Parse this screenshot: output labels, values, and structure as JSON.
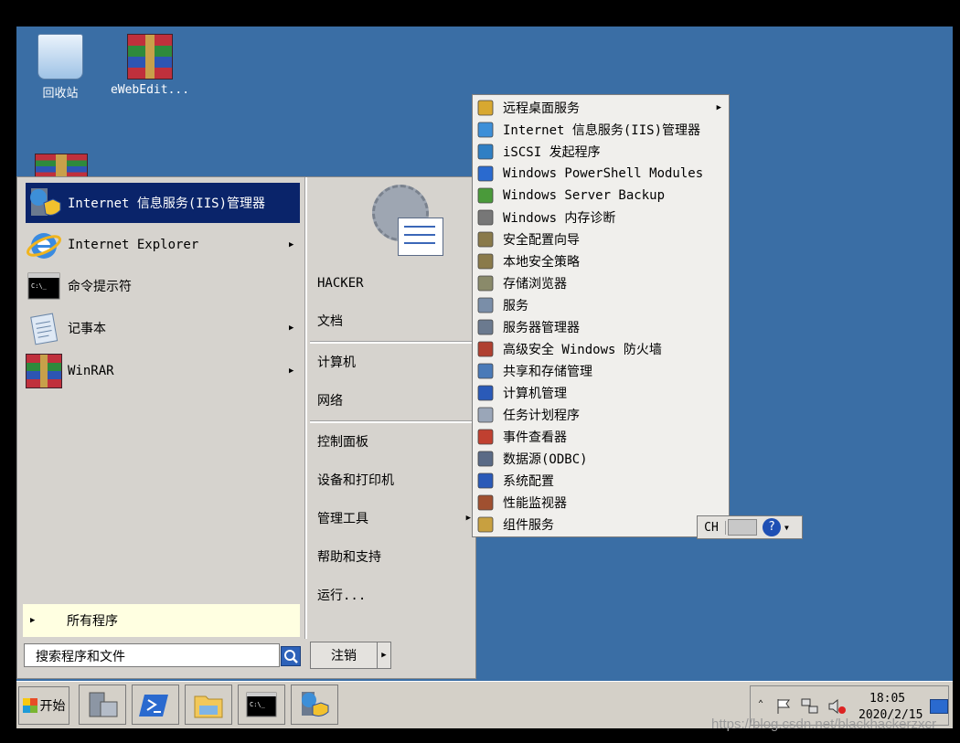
{
  "desktop": {
    "icons": [
      {
        "label": "回收站",
        "icon": "recycle-bin-icon"
      },
      {
        "label": "eWebEdit...",
        "icon": "winrar-archive-icon"
      }
    ]
  },
  "start_menu": {
    "pinned": [
      {
        "label": "Internet 信息服务(IIS)管理器",
        "icon": "iis-manager-icon",
        "selected": true,
        "submenu": false
      },
      {
        "label": "Internet Explorer",
        "icon": "internet-explorer-icon",
        "submenu": true
      },
      {
        "label": "命令提示符",
        "icon": "command-prompt-icon",
        "submenu": false
      },
      {
        "label": "记事本",
        "icon": "notepad-icon",
        "submenu": true
      },
      {
        "label": "WinRAR",
        "icon": "winrar-icon",
        "submenu": true
      }
    ],
    "all_programs": "所有程序",
    "search_placeholder": "搜索程序和文件",
    "right": {
      "user": "HACKER",
      "documents": "文档",
      "computer": "计算机",
      "network": "网络",
      "control_panel": "控制面板",
      "devices": "设备和打印机",
      "admin_tools": "管理工具",
      "help": "帮助和支持",
      "run": "运行..."
    },
    "logoff": "注销"
  },
  "admin_tools_menu": {
    "items": [
      {
        "label": "远程桌面服务",
        "icon": "folder-icon",
        "submenu": true
      },
      {
        "label": "Internet 信息服务(IIS)管理器",
        "icon": "iis-manager-icon"
      },
      {
        "label": "iSCSI 发起程序",
        "icon": "iscsi-globe-icon"
      },
      {
        "label": "Windows PowerShell Modules",
        "icon": "powershell-icon"
      },
      {
        "label": "Windows Server Backup",
        "icon": "backup-icon"
      },
      {
        "label": "Windows 内存诊断",
        "icon": "memory-chip-icon"
      },
      {
        "label": "安全配置向导",
        "icon": "security-wizard-icon"
      },
      {
        "label": "本地安全策略",
        "icon": "security-policy-icon"
      },
      {
        "label": "存储浏览器",
        "icon": "storage-explorer-icon"
      },
      {
        "label": "服务",
        "icon": "services-gear-icon"
      },
      {
        "label": "服务器管理器",
        "icon": "server-manager-icon"
      },
      {
        "label": "高级安全 Windows 防火墙",
        "icon": "firewall-icon"
      },
      {
        "label": "共享和存储管理",
        "icon": "share-storage-icon"
      },
      {
        "label": "计算机管理",
        "icon": "computer-management-icon"
      },
      {
        "label": "任务计划程序",
        "icon": "task-scheduler-icon"
      },
      {
        "label": "事件查看器",
        "icon": "event-viewer-icon"
      },
      {
        "label": "数据源(ODBC)",
        "icon": "odbc-icon"
      },
      {
        "label": "系统配置",
        "icon": "system-config-icon"
      },
      {
        "label": "性能监视器",
        "icon": "performance-monitor-icon"
      },
      {
        "label": "组件服务",
        "icon": "component-services-icon"
      }
    ]
  },
  "language_bar": {
    "lang": "CH",
    "help": "?"
  },
  "taskbar": {
    "start_label": "开始",
    "buttons": [
      {
        "icon": "server-manager-icon"
      },
      {
        "icon": "powershell-icon"
      },
      {
        "icon": "explorer-folder-icon"
      },
      {
        "icon": "command-prompt-icon"
      },
      {
        "icon": "iis-manager-icon"
      }
    ],
    "tray": {
      "time": "18:05",
      "date": "2020/2/15"
    }
  },
  "watermark": "https://blog.csdn.net/blackhackerzxcr",
  "colors": {
    "desktop": "#3a6ea5",
    "selection": "#0a246a",
    "menu": "#d6d3ce",
    "all_programs_bg": "#ffffe1"
  }
}
